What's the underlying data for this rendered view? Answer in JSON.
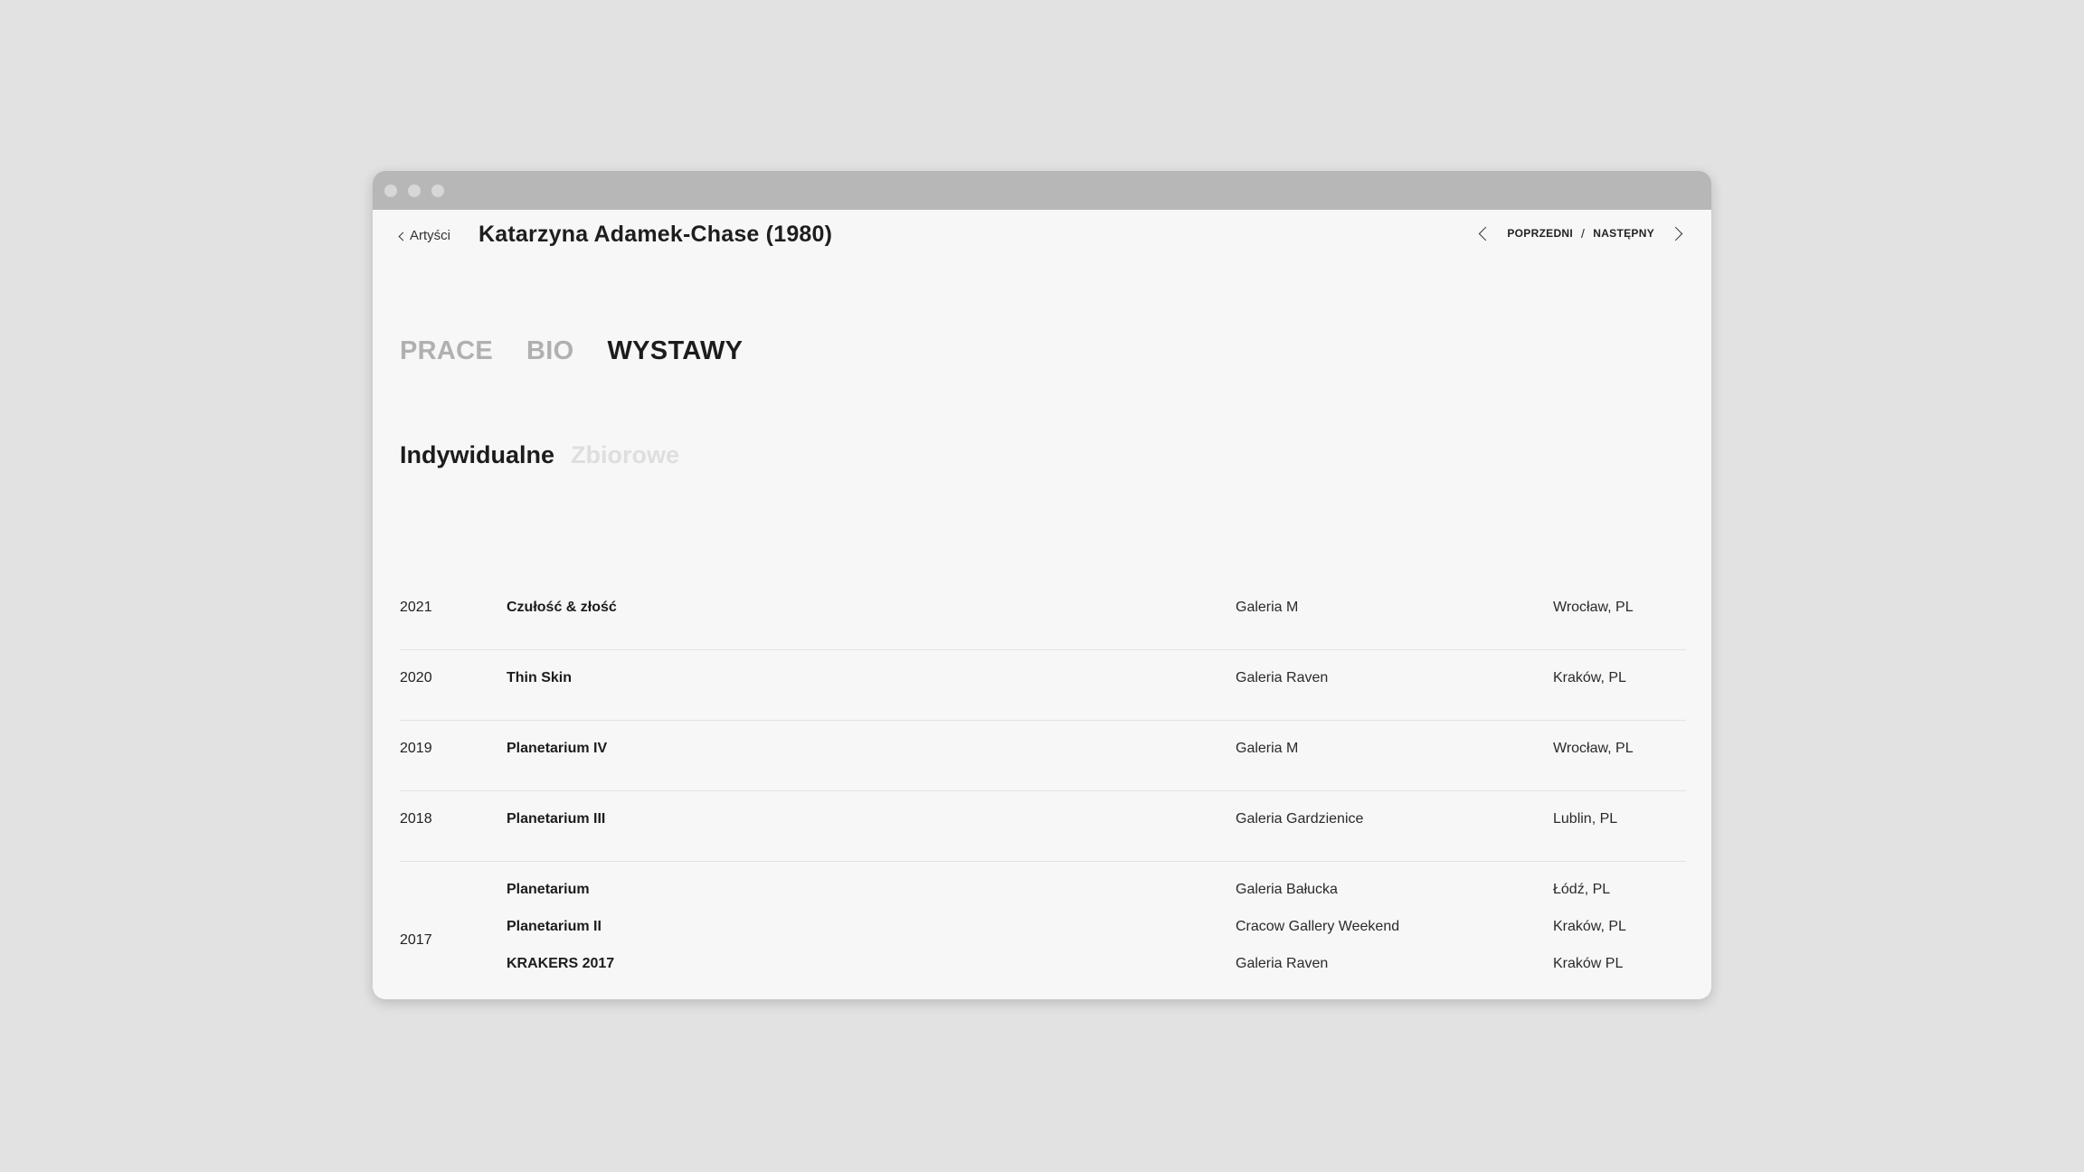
{
  "nav": {
    "back_label": "Artyści",
    "artist_title": "Katarzyna Adamek-Chase (1980)",
    "prev_label": "POPRZEDNI",
    "separator": "/",
    "next_label": "NASTĘPNY"
  },
  "main_tabs": [
    {
      "label": "PRACE",
      "active": false
    },
    {
      "label": "BIO",
      "active": false
    },
    {
      "label": "WYSTAWY",
      "active": true
    }
  ],
  "sub_tabs": [
    {
      "label": "Indywidualne",
      "active": true
    },
    {
      "label": "Zbiorowe",
      "active": false
    }
  ],
  "exhibitions": [
    {
      "year": "2021",
      "entries": [
        {
          "title": "Czułość & złość",
          "gallery": "Galeria M",
          "city": "Wrocław, PL"
        }
      ]
    },
    {
      "year": "2020",
      "entries": [
        {
          "title": "Thin Skin",
          "gallery": "Galeria Raven",
          "city": "Kraków, PL"
        }
      ]
    },
    {
      "year": "2019",
      "entries": [
        {
          "title": "Planetarium IV",
          "gallery": "Galeria M",
          "city": "Wrocław, PL"
        }
      ]
    },
    {
      "year": "2018",
      "entries": [
        {
          "title": "Planetarium III",
          "gallery": "Galeria Gardzienice",
          "city": "Lublin, PL"
        }
      ]
    },
    {
      "year": "2017",
      "entries": [
        {
          "title": "Planetarium",
          "gallery": "Galeria Bałucka",
          "city": "Łódź, PL"
        },
        {
          "title": "Planetarium II",
          "gallery": "Cracow Gallery Weekend",
          "city": "Kraków, PL"
        },
        {
          "title": "KRAKERS 2017",
          "gallery": "Galeria Raven",
          "city": "Kraków PL"
        }
      ]
    }
  ]
}
